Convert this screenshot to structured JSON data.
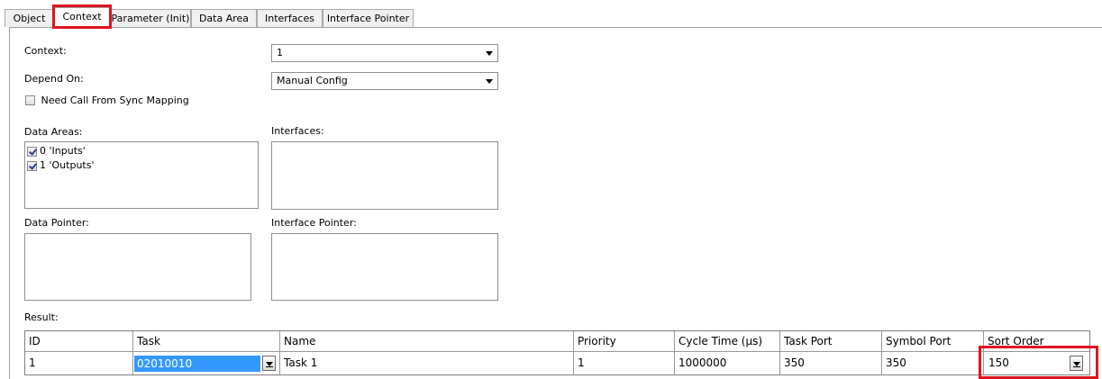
{
  "tabs": [
    "Object",
    "Context",
    "Parameter (Init)",
    "Data Area",
    "Interfaces",
    "Interface Pointer"
  ],
  "form": {
    "context_label": "Context:",
    "context_value": "1",
    "depend_on_label": "Depend On:",
    "depend_on_value": "Manual Config",
    "need_call_label": "Need Call From Sync Mapping",
    "need_call_checked": false,
    "data_areas_label": "Data Areas:",
    "data_areas": [
      {
        "label": "0 'Inputs'",
        "checked": true
      },
      {
        "label": "1 'Outputs'",
        "checked": true
      }
    ],
    "interfaces_label": "Interfaces:",
    "data_pointer_label": "Data Pointer:",
    "interface_pointer_label": "Interface Pointer:",
    "result_label": "Result:"
  },
  "result_table": {
    "columns": [
      "ID",
      "Task",
      "Name",
      "Priority",
      "Cycle Time (µs)",
      "Task Port",
      "Symbol Port",
      "Sort Order"
    ],
    "rows": [
      [
        "1",
        "02010010",
        "Task 1",
        "1",
        "1000000",
        "350",
        "350",
        "150"
      ]
    ]
  },
  "highlight_color": "#e0141e",
  "selection_color": "#3399ff"
}
